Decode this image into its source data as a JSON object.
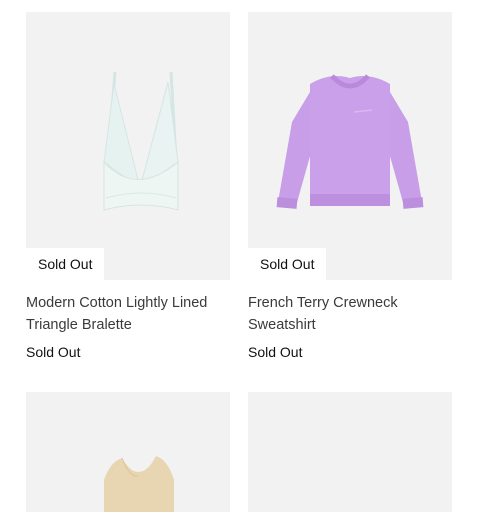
{
  "products": [
    {
      "name": "Modern Cotton Lightly Lined Triangle Bralette",
      "badge": "Sold Out",
      "status": "Sold Out",
      "swatch": "#e6f0ef"
    },
    {
      "name": "French Terry Crewneck Sweatshirt",
      "badge": "Sold Out",
      "status": "Sold Out",
      "swatch": "#c69be6"
    },
    {
      "name": "",
      "swatch": "#e8d6b3"
    },
    {
      "name": ""
    }
  ],
  "colors": {
    "image_bg": "#f2f2f2",
    "badge_bg": "#ffffff",
    "text": "#1f1f1f"
  }
}
